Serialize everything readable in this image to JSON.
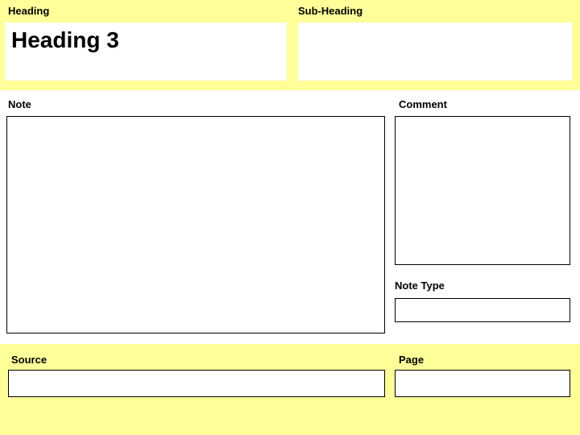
{
  "top": {
    "heading_label": "Heading",
    "subheading_label": "Sub-Heading",
    "heading_value": "Heading 3",
    "subheading_value": ""
  },
  "middle": {
    "note_label": "Note",
    "note_value": "",
    "comment_label": "Comment",
    "comment_value": "",
    "notetype_label": "Note Type",
    "notetype_value": ""
  },
  "bottom": {
    "source_label": "Source",
    "source_value": "",
    "page_label": "Page",
    "page_value": ""
  }
}
